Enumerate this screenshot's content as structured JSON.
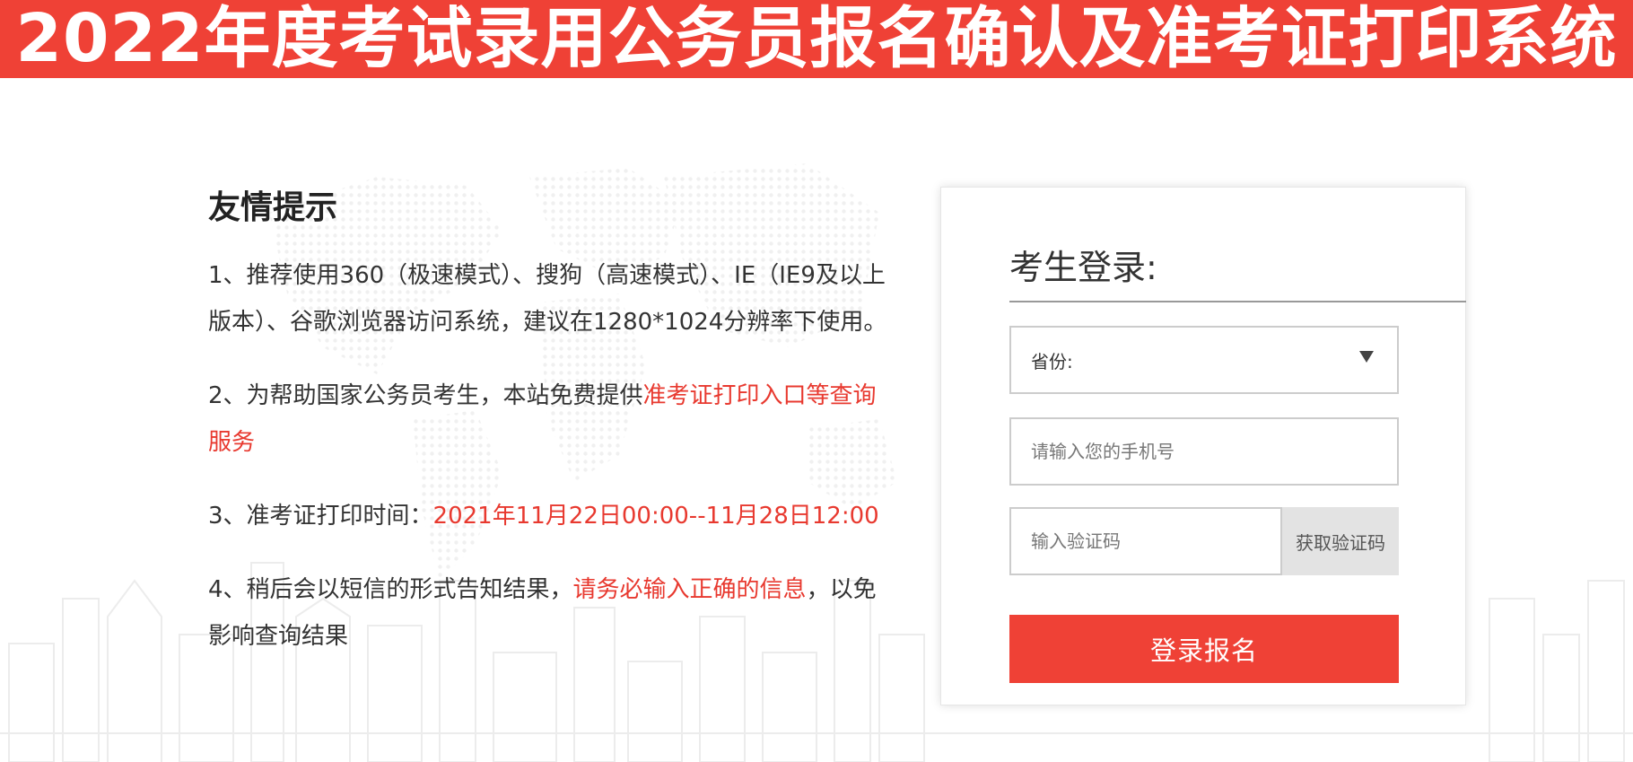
{
  "header": {
    "title": "2022年度考试录用公务员报名确认及准考证打印系统"
  },
  "tips": {
    "heading": "友情提示",
    "items": [
      {
        "parts": [
          {
            "text": "1、推荐使用360（极速模式）、搜狗（高速模式）、IE（IE9及以上版本）、谷歌浏览器访问系统，建议在1280*1024分辨率下使用。",
            "highlight": false
          }
        ]
      },
      {
        "parts": [
          {
            "text": "2、为帮助国家公务员考生，本站免费提供",
            "highlight": false
          },
          {
            "text": "准考证打印入口等查询服务",
            "highlight": true
          }
        ]
      },
      {
        "parts": [
          {
            "text": "3、准考证打印时间：",
            "highlight": false
          },
          {
            "text": "2021年11月22日00:00--11月28日12:00",
            "highlight": true
          }
        ]
      },
      {
        "parts": [
          {
            "text": "4、稍后会以短信的形式告知结果，",
            "highlight": false
          },
          {
            "text": "请务必输入正确的信息",
            "highlight": true
          },
          {
            "text": "，以免影响查询结果",
            "highlight": false
          }
        ]
      }
    ]
  },
  "login": {
    "title": "考生登录:",
    "province_label": "省份:",
    "phone_placeholder": "请输入您的手机号",
    "code_placeholder": "输入验证码",
    "get_code_label": "获取验证码",
    "submit_label": "登录报名"
  },
  "colors": {
    "brand_red": "#ef4136",
    "highlight_red": "#e8392f"
  }
}
